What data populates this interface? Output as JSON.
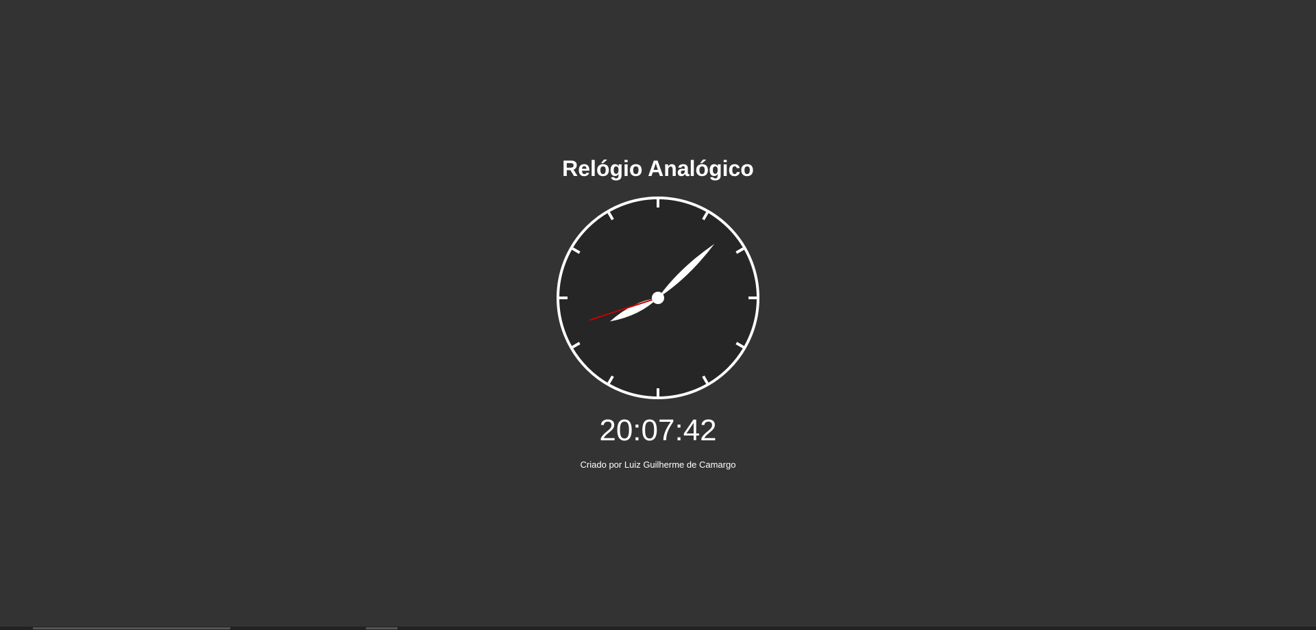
{
  "page": {
    "title": "Relógio Analógico",
    "digital_time": "20:07:42",
    "credit": "Criado por Luiz Guilherme de Camargo"
  },
  "clock": {
    "time": {
      "hours": 20,
      "minutes": 7,
      "seconds": 42
    },
    "colors": {
      "background": "#333333",
      "face": "#262626",
      "rim": "#ffffff",
      "ticks": "#ffffff",
      "hands": "#ffffff",
      "second_hand": "#cc0000",
      "center": "#ffffff"
    }
  }
}
